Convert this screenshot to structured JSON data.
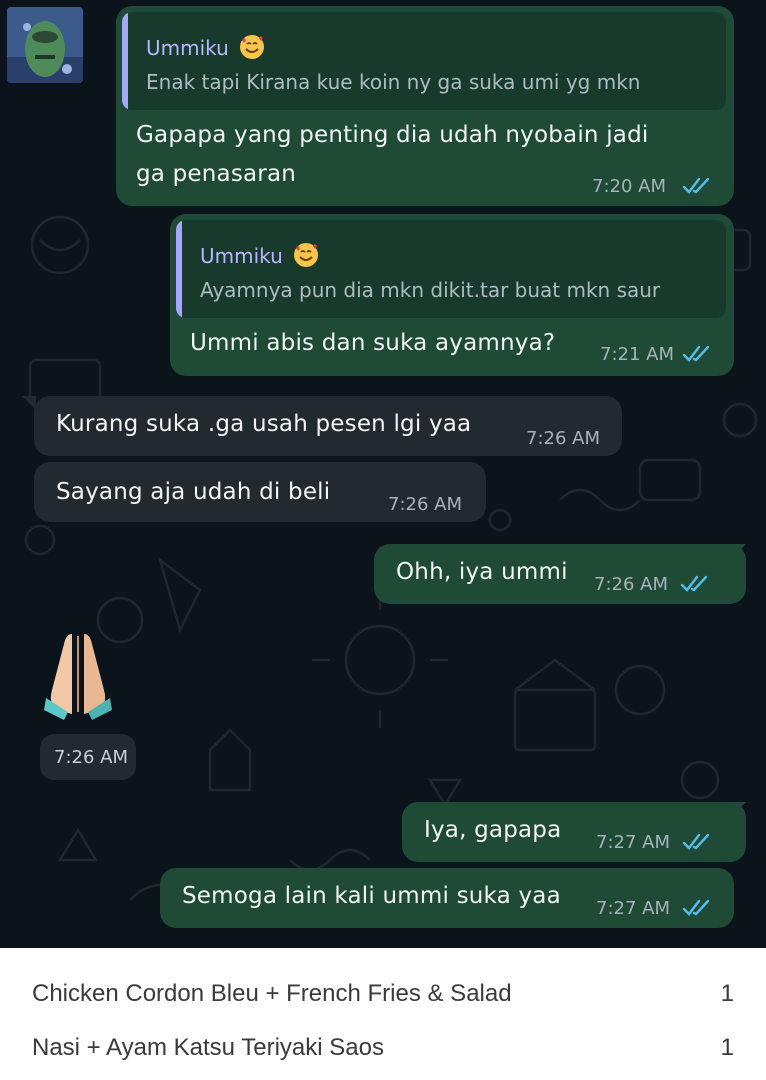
{
  "chat": {
    "contact_avatar_icon": "avatar-cartoon-icon",
    "messages": [
      {
        "direction": "outgoing",
        "quote": {
          "name": "Ummiku",
          "text": "Enak tapi Kirana kue koin ny ga suka umi yg mkn"
        },
        "lines": [
          "Gapapa yang penting dia udah nyobain jadi",
          "ga penasaran"
        ],
        "time": "7:20 AM",
        "status": "read"
      },
      {
        "direction": "outgoing",
        "quote": {
          "name": "Ummiku",
          "text": "Ayamnya pun dia mkn dikit.tar buat mkn saur"
        },
        "lines": [
          "Ummi abis dan suka ayamnya?"
        ],
        "time": "7:21 AM",
        "status": "read"
      },
      {
        "direction": "incoming",
        "lines": [
          "Kurang suka .ga usah pesen lgi yaa"
        ],
        "time": "7:26 AM"
      },
      {
        "direction": "incoming",
        "lines": [
          "Sayang aja udah di beli"
        ],
        "time": "7:26 AM"
      },
      {
        "direction": "outgoing",
        "lines": [
          "Ohh, iya ummi"
        ],
        "time": "7:26 AM",
        "status": "read"
      },
      {
        "direction": "incoming",
        "sticker": "folded-hands-emoji-icon",
        "time": "7:26 AM"
      },
      {
        "direction": "outgoing",
        "lines": [
          "Iya, gapapa"
        ],
        "time": "7:27 AM",
        "status": "read"
      },
      {
        "direction": "outgoing",
        "lines": [
          "Semoga lain kali ummi suka yaa"
        ],
        "time": "7:27 AM",
        "status": "read"
      }
    ],
    "quote_emoji_icon": "smiling-face-with-hearts-icon",
    "read_ticks_icon": "double-check-icon",
    "colors": {
      "background": "#0b141a",
      "outgoing_bubble": "#1e4a36",
      "incoming_bubble": "#232a2f",
      "read_ticks": "#53bdeb",
      "quote_name": "#b8b7ff"
    }
  },
  "order_list": {
    "items": [
      {
        "name": "Chicken Cordon Bleu + French Fries & Salad",
        "qty": "1"
      },
      {
        "name": "Nasi + Ayam Katsu Teriyaki Saos",
        "qty": "1"
      }
    ]
  }
}
